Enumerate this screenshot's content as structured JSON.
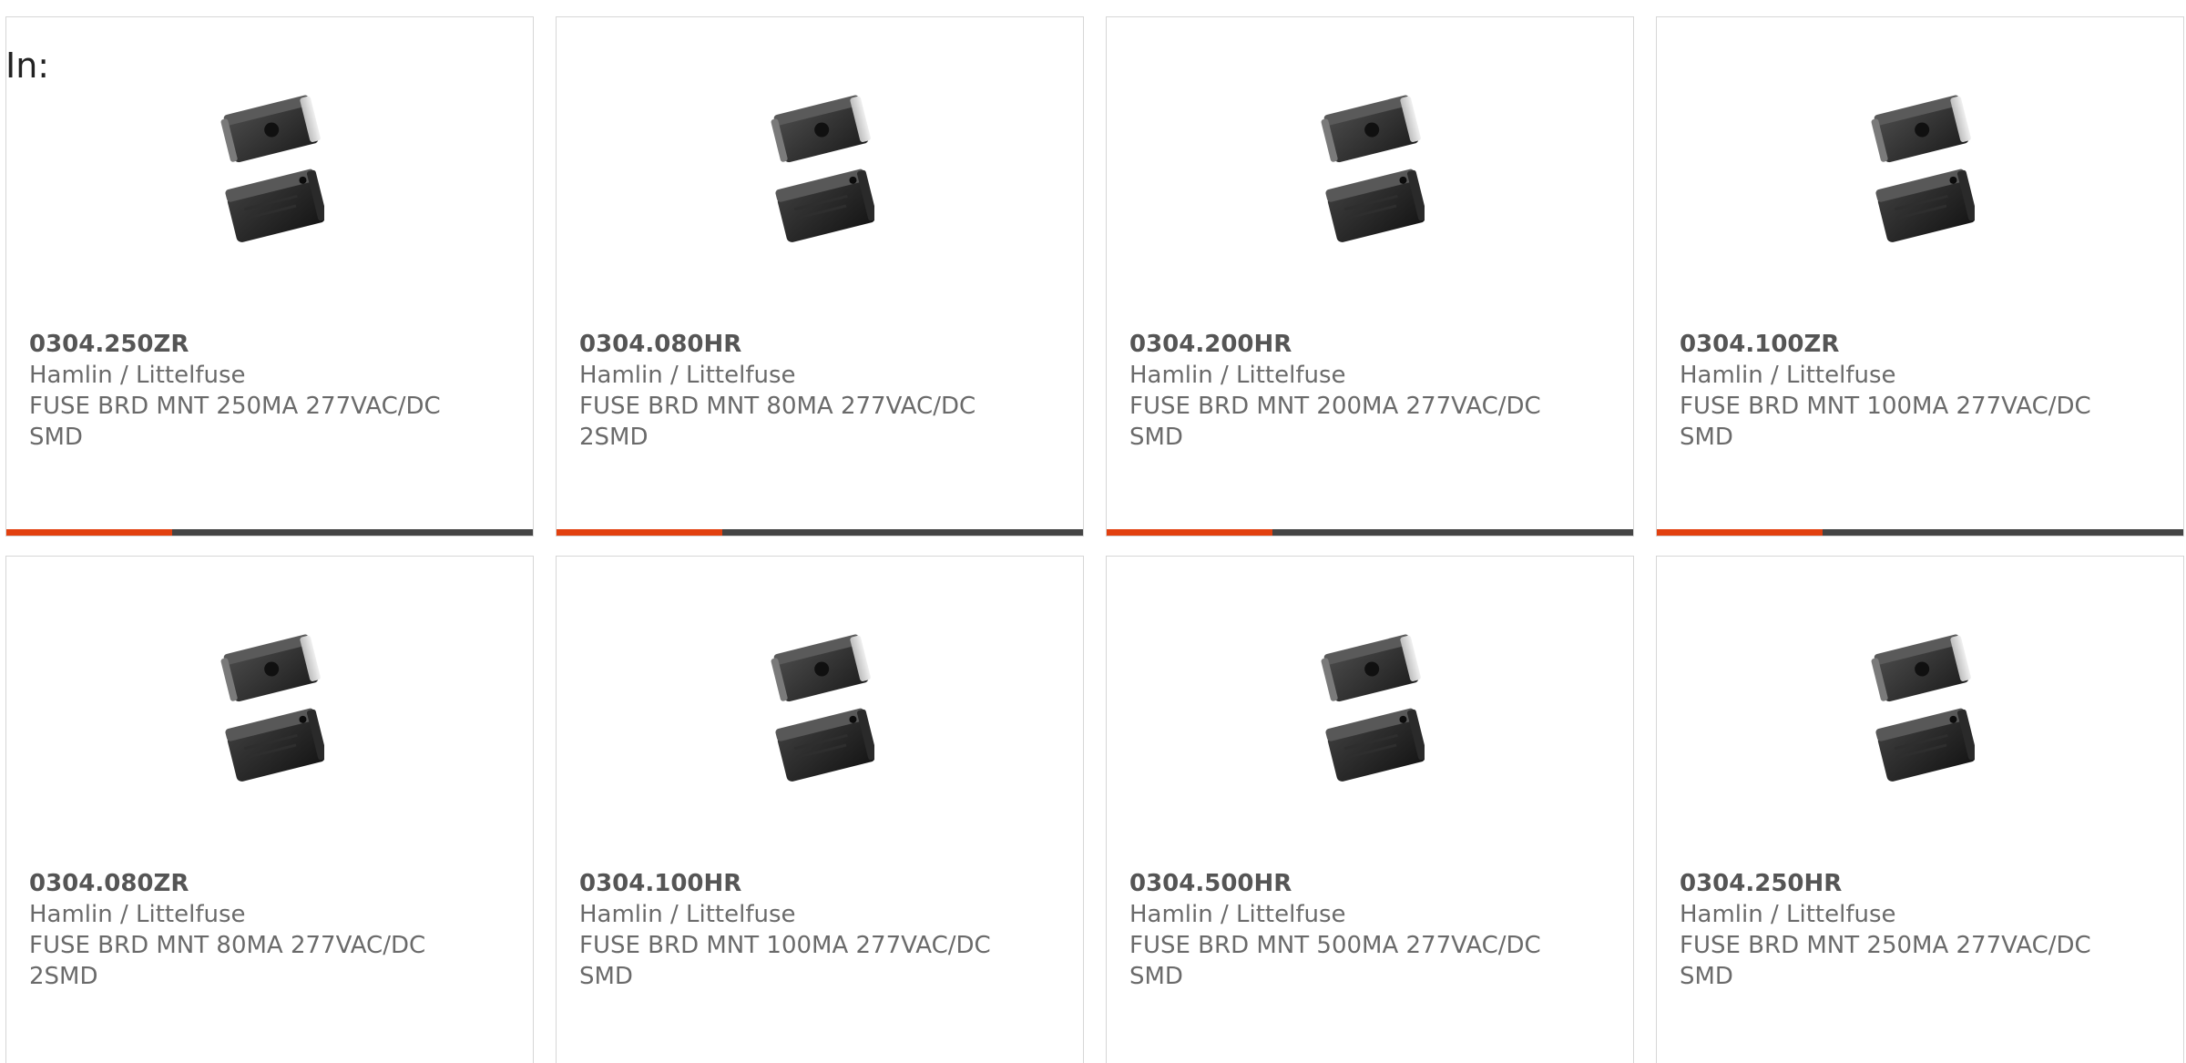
{
  "header": {
    "in_label": "In:"
  },
  "colors": {
    "accent": "#e2400f",
    "bar": "#444444",
    "text": "#666666"
  },
  "products": [
    {
      "part_number": "0304.250ZR",
      "manufacturer": "Hamlin / Littelfuse",
      "description": "FUSE BRD MNT 250MA 277VAC/DC SMD",
      "icon": "smd-fuse-product-image"
    },
    {
      "part_number": "0304.080HR",
      "manufacturer": "Hamlin / Littelfuse",
      "description": "FUSE BRD MNT 80MA 277VAC/DC 2SMD",
      "icon": "smd-fuse-product-image"
    },
    {
      "part_number": "0304.200HR",
      "manufacturer": "Hamlin / Littelfuse",
      "description": "FUSE BRD MNT 200MA 277VAC/DC SMD",
      "icon": "smd-fuse-product-image"
    },
    {
      "part_number": "0304.100ZR",
      "manufacturer": "Hamlin / Littelfuse",
      "description": "FUSE BRD MNT 100MA 277VAC/DC SMD",
      "icon": "smd-fuse-product-image"
    },
    {
      "part_number": "0304.080ZR",
      "manufacturer": "Hamlin / Littelfuse",
      "description": "FUSE BRD MNT 80MA 277VAC/DC 2SMD",
      "icon": "smd-fuse-product-image"
    },
    {
      "part_number": "0304.100HR",
      "manufacturer": "Hamlin / Littelfuse",
      "description": "FUSE BRD MNT 100MA 277VAC/DC SMD",
      "icon": "smd-fuse-product-image"
    },
    {
      "part_number": "0304.500HR",
      "manufacturer": "Hamlin / Littelfuse",
      "description": "FUSE BRD MNT 500MA 277VAC/DC SMD",
      "icon": "smd-fuse-product-image"
    },
    {
      "part_number": "0304.250HR",
      "manufacturer": "Hamlin / Littelfuse",
      "description": "FUSE BRD MNT 250MA 277VAC/DC SMD",
      "icon": "smd-fuse-product-image"
    }
  ]
}
